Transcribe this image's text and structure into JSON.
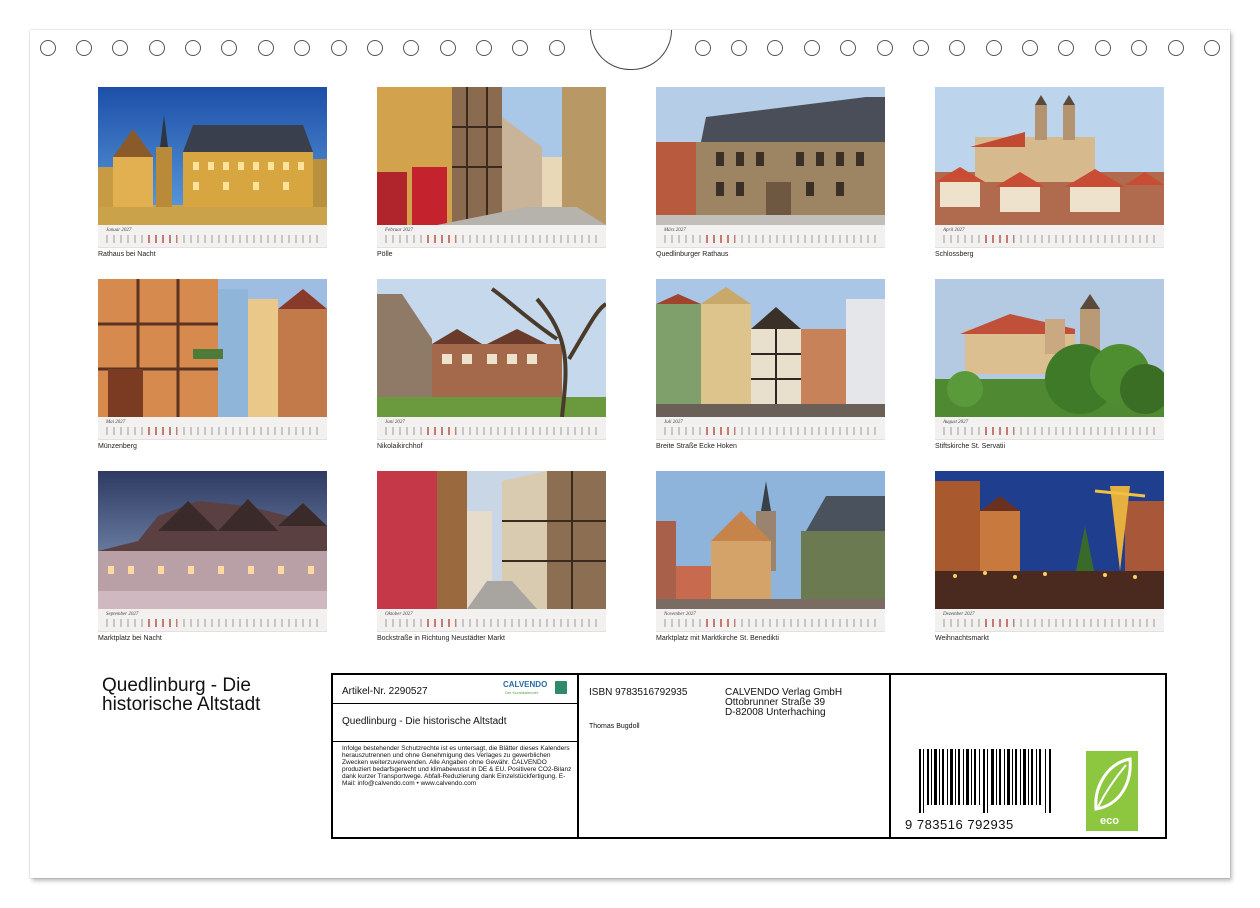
{
  "months": [
    {
      "month": "Januar 2027",
      "caption": "Rathaus bei Nacht"
    },
    {
      "month": "Februar 2027",
      "caption": "Pölle"
    },
    {
      "month": "März 2027",
      "caption": "Quedlinburger Rathaus"
    },
    {
      "month": "April 2027",
      "caption": "Schlossberg"
    },
    {
      "month": "Mai 2027",
      "caption": "Münzenberg"
    },
    {
      "month": "Juni 2027",
      "caption": "Nikolaikirchhof"
    },
    {
      "month": "Juli 2027",
      "caption": "Breite Straße Ecke Hoken"
    },
    {
      "month": "August 2027",
      "caption": "Stiftskirche St. Servatii"
    },
    {
      "month": "September 2027",
      "caption": "Marktplatz bei Nacht"
    },
    {
      "month": "Oktober 2027",
      "caption": "Bockstraße in Richtung Neustädter Markt"
    },
    {
      "month": "November 2027",
      "caption": "Marktplatz mit Marktkirche St. Benedikti"
    },
    {
      "month": "Dezember 2027",
      "caption": "Weihnachtsmarkt"
    }
  ],
  "title": "Quedlinburg - Die historische Altstadt",
  "info": {
    "article": "Artikel-Nr. 2290527",
    "logo": "CALVENDO",
    "logo_sub": "Der Kunstkalender",
    "product_title": "Quedlinburg - Die historische Altstadt",
    "legal": "Infolge bestehender Schutzrechte ist es untersagt, die Blätter dieses Kalenders herauszutrennen und ohne Genehmigung des Verlages zu gewerblichen Zwecken weiterzuverwenden. Alle Angaben ohne Gewähr. CALVENDO produziert bedarfsgerecht und klimabewusst in DE & EU. Positivere CO2-Bilanz dank kurzer Transportwege. Abfall-Reduzierung dank Einzelstückfertigung. E-Mail: info@calvendo.com • www.calvendo.com",
    "isbn": "ISBN 9783516792935",
    "author": "Thomas Bugdoll",
    "publisher_1": "CALVENDO Verlag GmbH",
    "publisher_2": "Ottobrunner Straße 39",
    "publisher_3": "D-82008 Unterhaching",
    "barcode_number": "9 783516 792935",
    "eco_label": "eco"
  }
}
